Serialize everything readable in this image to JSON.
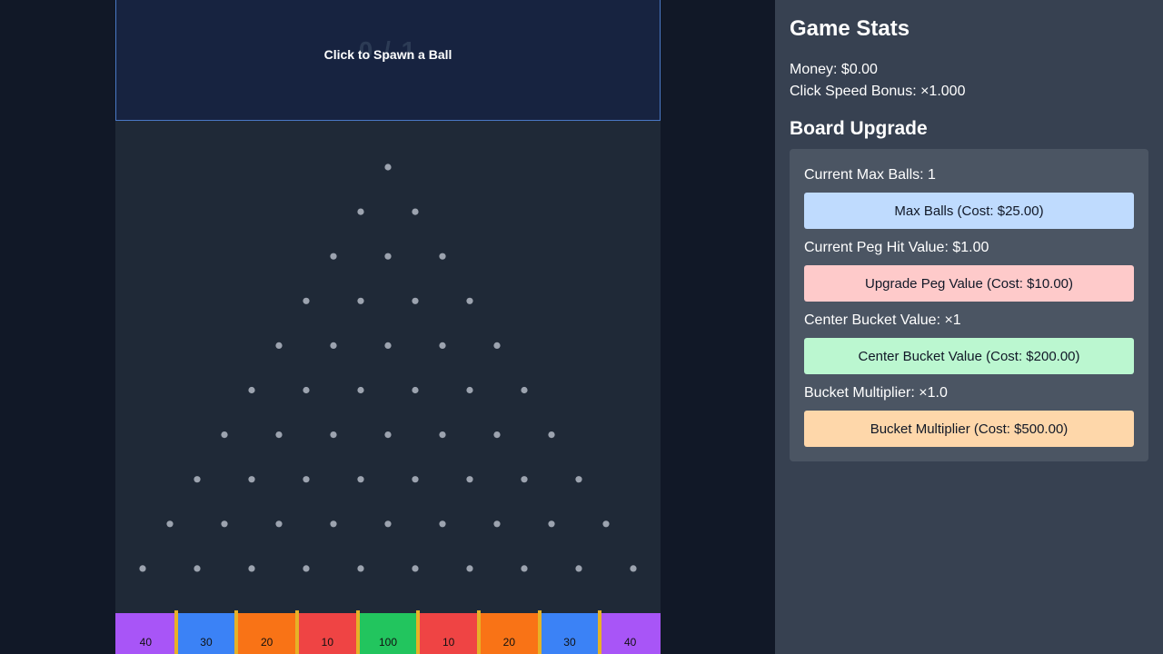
{
  "board": {
    "ball_counter": "0 / 1",
    "spawn_label": "Click to Spawn a Ball",
    "peg_color": "#9ca3af",
    "buckets": [
      {
        "value": "40",
        "color": "#a855f7"
      },
      {
        "value": "30",
        "color": "#3b82f6"
      },
      {
        "value": "20",
        "color": "#f97316"
      },
      {
        "value": "10",
        "color": "#ef4444"
      },
      {
        "value": "100",
        "color": "#22c55e"
      },
      {
        "value": "10",
        "color": "#ef4444"
      },
      {
        "value": "20",
        "color": "#f97316"
      },
      {
        "value": "30",
        "color": "#3b82f6"
      },
      {
        "value": "40",
        "color": "#a855f7"
      }
    ]
  },
  "stats": {
    "title": "Game Stats",
    "money": "Money: $0.00",
    "click_speed_bonus": "Click Speed Bonus: ×1.000"
  },
  "upgrades": {
    "title": "Board Upgrade",
    "max_balls_label": "Current Max Balls: 1",
    "max_balls_button": "Max Balls (Cost: $25.00)",
    "peg_value_label": "Current Peg Hit Value: $1.00",
    "peg_value_button": "Upgrade Peg Value (Cost: $10.00)",
    "center_bucket_label": "Center Bucket Value: ×1",
    "center_bucket_button": "Center Bucket Value (Cost: $200.00)",
    "bucket_multiplier_label": "Bucket Multiplier: ×1.0",
    "bucket_multiplier_button": "Bucket Multiplier (Cost: $500.00)",
    "colors": {
      "max_balls": "#bfdbfe",
      "peg_value": "#fecaca",
      "center_bucket": "#bbf7d0",
      "bucket_multiplier": "#fed7aa"
    }
  }
}
